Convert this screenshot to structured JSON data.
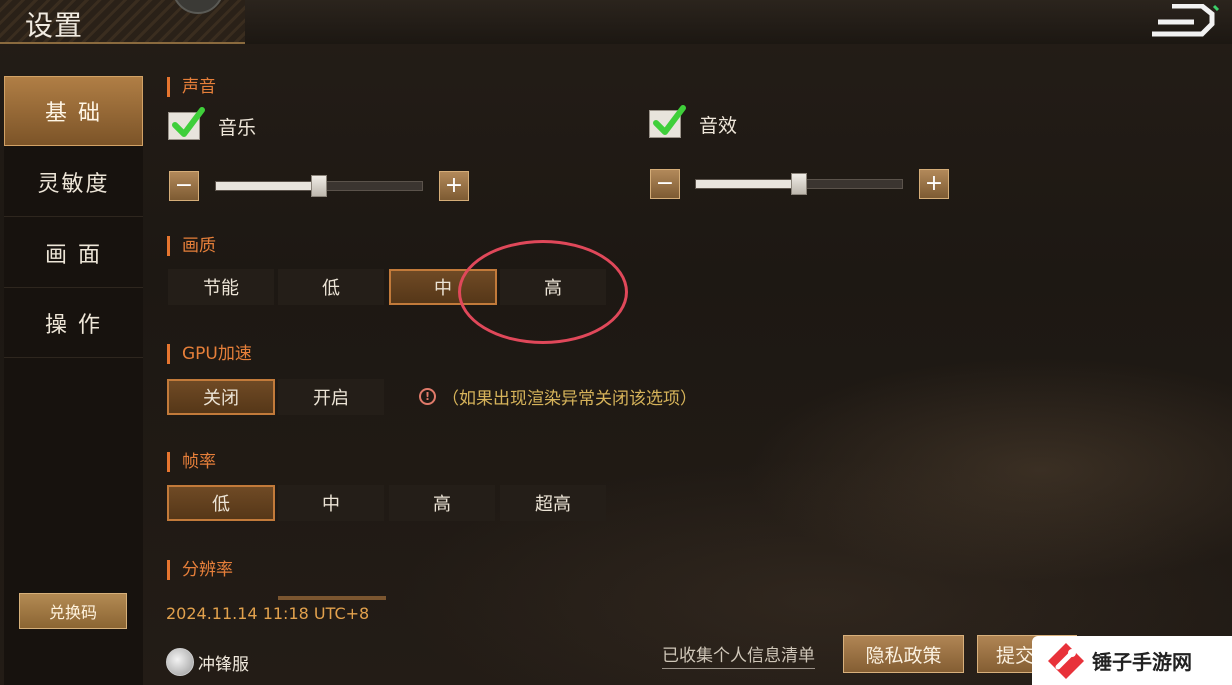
{
  "header": {
    "title": "设置"
  },
  "sidebar": {
    "tabs": [
      {
        "label": "基 础",
        "active": true
      },
      {
        "label": "灵敏度",
        "active": false
      },
      {
        "label": "画 面",
        "active": false
      },
      {
        "label": "操 作",
        "active": false
      }
    ],
    "redeem_label": "兑换码"
  },
  "sound": {
    "title": "声音",
    "music": {
      "label": "音乐",
      "checked": true,
      "volume": 0.5
    },
    "effects": {
      "label": "音效",
      "checked": true,
      "volume": 0.5
    },
    "minus": "−",
    "plus": "+"
  },
  "quality": {
    "title": "画质",
    "options": [
      "节能",
      "低",
      "中",
      "高"
    ],
    "selected": "中"
  },
  "gpu": {
    "title": "GPU加速",
    "options": [
      "关闭",
      "开启"
    ],
    "selected": "关闭",
    "hint_icon": "!",
    "hint": "（如果出现渲染异常关闭该选项）"
  },
  "framerate": {
    "title": "帧率",
    "options": [
      "低",
      "中",
      "高",
      "超高"
    ],
    "selected": "低"
  },
  "resolution": {
    "title": "分辨率"
  },
  "footer": {
    "timestamp": "2024.11.14 11:18 UTC+8",
    "server": "冲锋服",
    "collected_info": "已收集个人信息清单",
    "privacy_button": "隐私政策",
    "submit_button": "提交"
  },
  "watermark": {
    "text": "锤子手游网"
  },
  "colors": {
    "accent_orange": "#e67f3a",
    "selected_border": "#c27a3a",
    "checkbox_green": "#3fcf3a",
    "annotation_red": "#e0485a"
  }
}
